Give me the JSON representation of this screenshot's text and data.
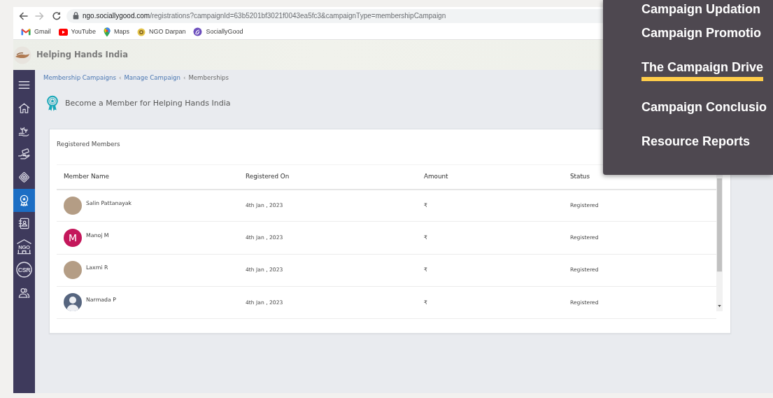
{
  "browser": {
    "nav_buttons": [
      {
        "kind": "back",
        "disabled": false
      },
      {
        "kind": "forward",
        "disabled": true
      },
      {
        "kind": "reload",
        "disabled": false
      }
    ],
    "url": {
      "host": "ngo.sociallygood.com",
      "path": "/registrations?campaignId=63b5201bf3021f0043ea5fc3&campaignType=membershipCampaign"
    },
    "bookmarks": [
      {
        "kind": "gmail",
        "label": "Gmail"
      },
      {
        "kind": "youtube",
        "label": "YouTube"
      },
      {
        "kind": "maps",
        "label": "Maps"
      },
      {
        "kind": "emblem",
        "label": "NGO Darpan"
      },
      {
        "kind": "swirl",
        "label": "SociallyGood"
      }
    ]
  },
  "app_header": {
    "title": "Helping Hands India"
  },
  "sidebar": {
    "items": [
      {
        "kind": "menu",
        "selected": false
      },
      {
        "kind": "home",
        "selected": false
      },
      {
        "kind": "plant",
        "selected": false
      },
      {
        "kind": "hand",
        "selected": false
      },
      {
        "kind": "diamond",
        "selected": false
      },
      {
        "kind": "award",
        "selected": true
      },
      {
        "kind": "contacts",
        "selected": false
      },
      {
        "kind": "building",
        "label": "NGO",
        "selected": false
      },
      {
        "kind": "csr",
        "label": "CSR",
        "selected": false
      },
      {
        "kind": "people",
        "selected": false
      }
    ]
  },
  "breadcrumb": {
    "items": [
      {
        "label": "Membership Campaigns",
        "link": true,
        "separator": "‹"
      },
      {
        "label": "Manage Campaign",
        "link": true,
        "separator": "‹"
      },
      {
        "label": "Memberships",
        "link": false
      }
    ]
  },
  "page_title": "Become a Member for Helping Hands India",
  "card": {
    "title": "Registered Members",
    "columns": [
      "Member Name",
      "Registered On",
      "Amount",
      "Status"
    ],
    "rows": [
      {
        "avatar": {
          "kind": "photo"
        },
        "name": "Salin Pattanayak",
        "registered_on": "4th Jan , 2023",
        "amount": "₹",
        "status": "Registered"
      },
      {
        "avatar": {
          "kind": "initial",
          "initial": "M"
        },
        "name": "Manoj M",
        "registered_on": "4th Jan , 2023",
        "amount": "₹",
        "status": "Registered"
      },
      {
        "avatar": {
          "kind": "photo"
        },
        "name": "Laxmi R",
        "registered_on": "4th Jan , 2023",
        "amount": "₹",
        "status": "Registered"
      },
      {
        "avatar": {
          "kind": "default"
        },
        "name": "Narmada P",
        "registered_on": "4th Jan , 2023",
        "amount": "₹",
        "status": "Registered"
      }
    ]
  },
  "overlay_menu": {
    "items": [
      {
        "label": "Campaign Updation",
        "selected": false
      },
      {
        "label": "Campaign Promotio",
        "selected": false
      },
      {
        "label": "The Campaign Drive",
        "selected": true
      },
      {
        "label": "Campaign Conclusio",
        "selected": false
      },
      {
        "label": "Resource Reports",
        "selected": false
      }
    ]
  }
}
